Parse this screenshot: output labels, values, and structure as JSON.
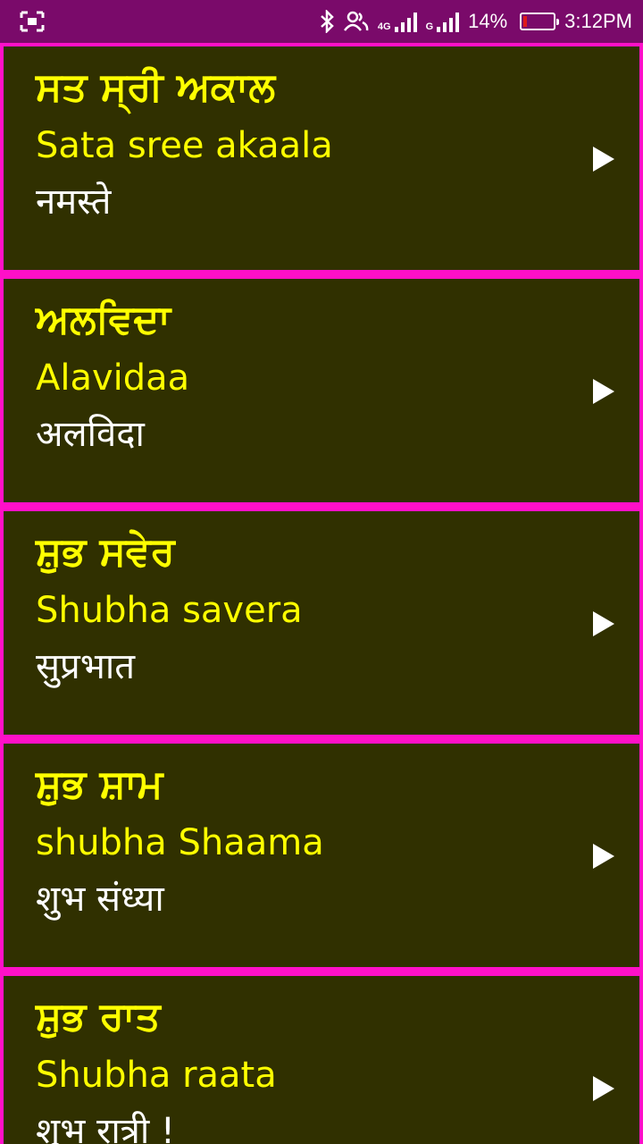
{
  "status_bar": {
    "network_1": "4G",
    "network_2": "G",
    "battery_percent_text": "14%",
    "battery_level": 0.14,
    "time": "3:12PM",
    "icons": [
      "screenshot-icon",
      "bluetooth-icon",
      "contacts-icon",
      "signal-icon",
      "battery-icon"
    ]
  },
  "colors": {
    "status_bar_bg": "#7a0a6a",
    "divider": "#ff10c8",
    "card_bg": "#303000",
    "primary_text": "#ffff00",
    "secondary_text": "#ffffff",
    "battery_low": "#e01818"
  },
  "phrases": [
    {
      "punjabi": "ਸਤ ਸ੍ਰੀ ਅਕਾਲ",
      "transliteration": "Sata sree akaala",
      "hindi": "नमस्ते"
    },
    {
      "punjabi": "ਅਲਵਿਦਾ",
      "transliteration": "Alavidaa",
      "hindi": "अलविदा"
    },
    {
      "punjabi": "ਸ਼ੁਭ ਸਵੇਰ",
      "transliteration": "Shubha savera",
      "hindi": "सुप्रभात"
    },
    {
      "punjabi": "ਸ਼ੁਭ ਸ਼ਾਮ",
      "transliteration": "shubha Shaama",
      "hindi": "शुभ संध्या"
    },
    {
      "punjabi": "ਸ਼ੁਭ ਰਾਤ",
      "transliteration": "Shubha raata",
      "hindi": "शुभ रात्री !"
    }
  ]
}
